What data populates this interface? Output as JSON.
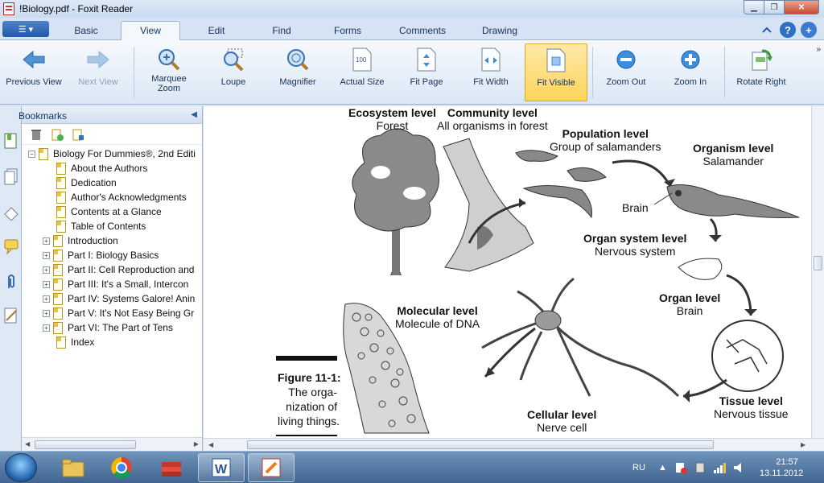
{
  "window": {
    "title": "!Biology.pdf - Foxit Reader"
  },
  "tabs": [
    "Basic",
    "View",
    "Edit",
    "Find",
    "Forms",
    "Comments",
    "Drawing"
  ],
  "active_tab": "View",
  "toolbar": {
    "previous_view": "Previous View",
    "next_view": "Next View",
    "marquee_zoom": "Marquee Zoom",
    "loupe": "Loupe",
    "magnifier": "Magnifier",
    "actual_size": "Actual Size",
    "fit_page": "Fit Page",
    "fit_width": "Fit Width",
    "fit_visible": "Fit Visible",
    "zoom_out": "Zoom Out",
    "zoom_in": "Zoom In",
    "rotate_right": "Rotate Right"
  },
  "bookmarks": {
    "title": "Bookmarks",
    "items": [
      "Biology For Dummies®, 2nd Editi",
      "About the Authors",
      "Dedication",
      "Author's Acknowledgments",
      "Contents at a Glance",
      "Table of Contents",
      "Introduction",
      "Part I: Biology Basics",
      "Part II: Cell Reproduction and",
      "Part III: It's a Small, Intercon",
      "Part IV: Systems Galore! Anin",
      "Part V: It's Not Easy Being Gr",
      "Part VI: The Part of Tens",
      "Index"
    ]
  },
  "figure": {
    "ecosystem_title": "Ecosystem level",
    "ecosystem_sub": "Forest",
    "community_title": "Community level",
    "community_sub": "All organisms in forest",
    "population_title": "Population level",
    "population_sub": "Group of salamanders",
    "organism_title": "Organism level",
    "organism_sub": "Salamander",
    "brain_label": "Brain",
    "organ_system_title": "Organ system level",
    "organ_system_sub": "Nervous system",
    "organ_title": "Organ level",
    "organ_sub": "Brain",
    "molecular_title": "Molecular level",
    "molecular_sub": "Molecule of DNA",
    "tissue_title": "Tissue level",
    "tissue_sub": "Nervous tissue",
    "cellular_title": "Cellular level",
    "cellular_sub": "Nerve cell",
    "caption_label": "Figure 11-1:",
    "caption_line1": "The orga-",
    "caption_line2": "nization of",
    "caption_line3": "living things."
  },
  "taskbar": {
    "language": "RU",
    "time": "21:57",
    "date": "13.11.2012"
  },
  "colors": {
    "ribbon_bg": "#dbe7f5",
    "active_tool": "#ffd45a",
    "taskbar": "#4a6f9a"
  }
}
